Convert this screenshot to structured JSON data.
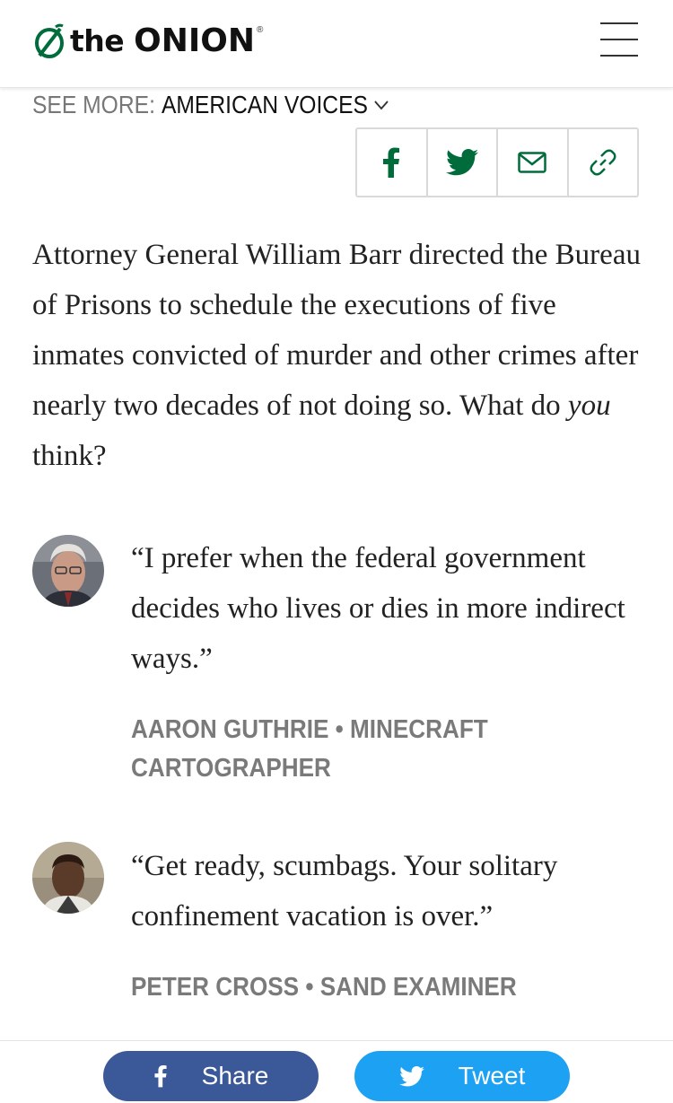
{
  "header": {
    "logo_word_the": "the",
    "logo_word_onion": "ONION",
    "logo_reg": "®",
    "menu_icon": "hamburger-icon"
  },
  "section": {
    "see_more_label": "SEE MORE:",
    "category": "AMERICAN VOICES"
  },
  "share_icons": [
    "facebook-icon",
    "twitter-icon",
    "email-icon",
    "link-icon"
  ],
  "colors": {
    "brand_green": "#006c3b",
    "facebook_blue": "#3b5998",
    "twitter_blue": "#1da1f2",
    "byline_gray": "#7a7a7a"
  },
  "lede": {
    "text_before": "Attorney General William Barr directed the Bureau of Prisons to schedule the executions of five inmates convicted of murder and other crimes after nearly two decades of not doing so. What do ",
    "emphasis": "you",
    "text_after": " think?"
  },
  "voices": [
    {
      "quote": "“I prefer when the federal government decides who lives or dies in more indirect ways.”",
      "byline": "AARON GUTHRIE • MINECRAFT CARTOGRAPHER"
    },
    {
      "quote": "“Get ready, scumbags. Your solitary confinement vacation is over.”",
      "byline": "PETER CROSS • SAND EXAMINER"
    }
  ],
  "bottom": {
    "share_label": "Share",
    "tweet_label": "Tweet"
  }
}
